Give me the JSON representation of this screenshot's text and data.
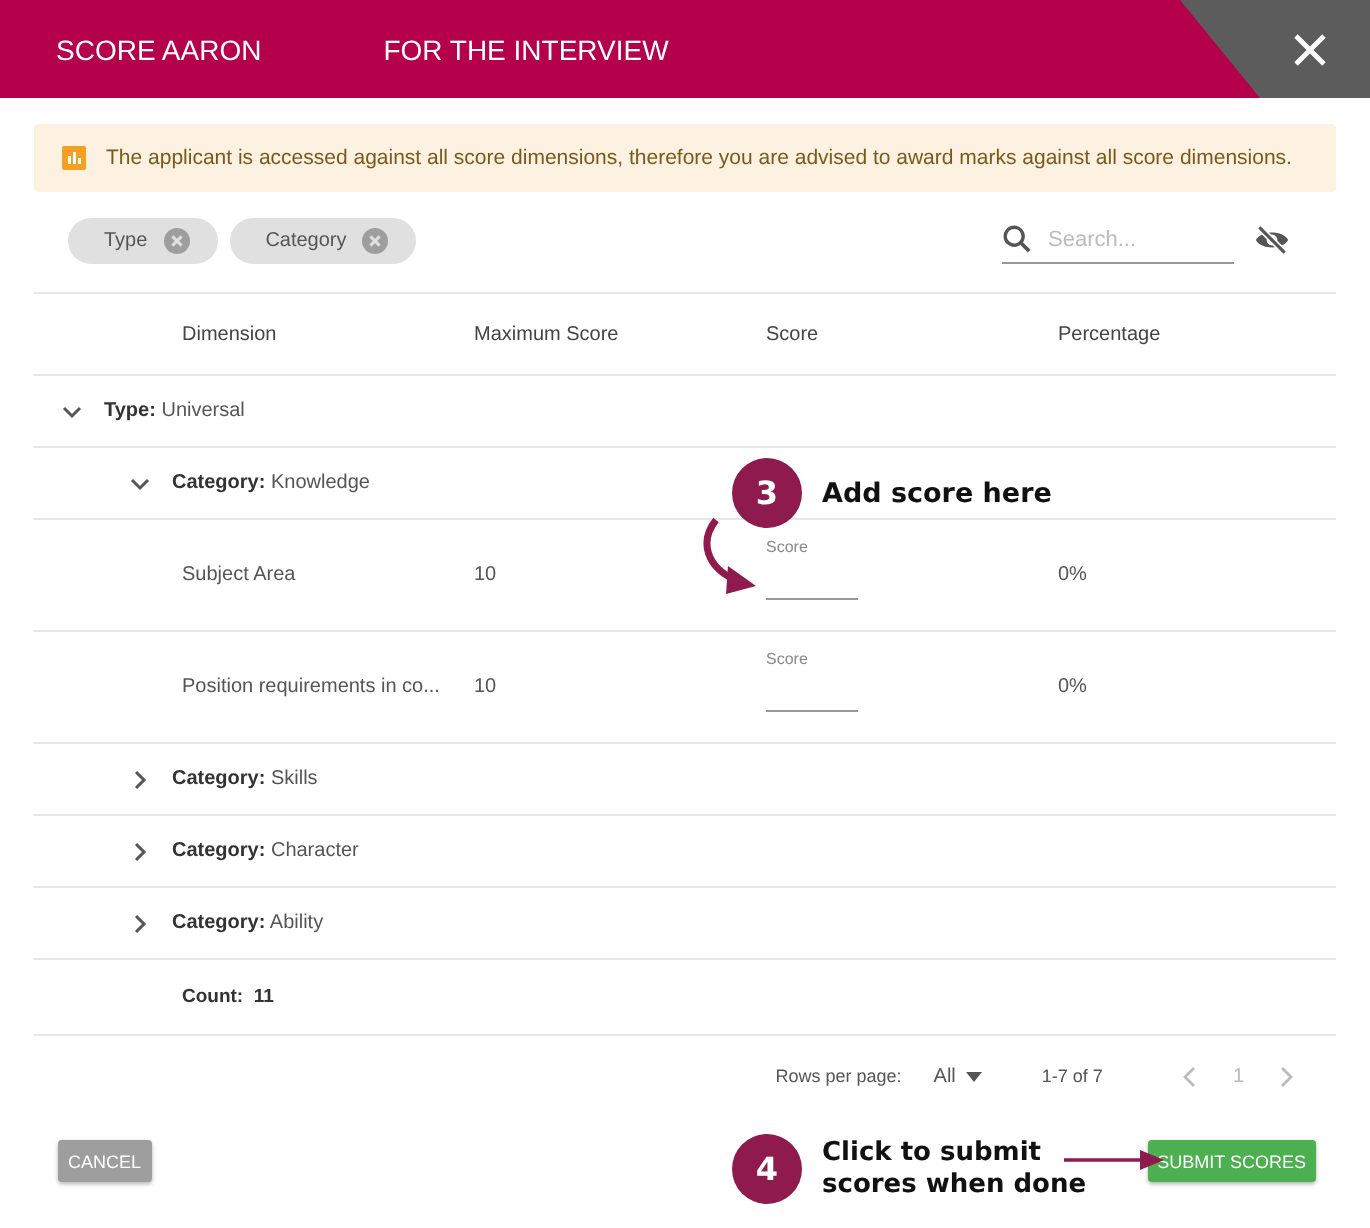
{
  "header": {
    "title": "SCORE AARON",
    "subtitle": "FOR THE INTERVIEW"
  },
  "alert": "The applicant is accessed against all score dimensions, therefore you are advised to award marks against all score dimensions.",
  "chips": [
    {
      "label": "Type"
    },
    {
      "label": "Category"
    }
  ],
  "search": {
    "placeholder": "Search..."
  },
  "table": {
    "columns": [
      "Dimension",
      "Maximum Score",
      "Score",
      "Percentage"
    ],
    "tree": [
      {
        "key": "Type:",
        "value": "Universal",
        "expanded": true,
        "children": [
          {
            "key": "Category:",
            "value": "Knowledge",
            "expanded": true,
            "children": [
              {
                "dimension": "Subject Area",
                "maximum_score": "10",
                "score_label": "Score",
                "percentage": "0%"
              },
              {
                "dimension": "Position requirements in co...",
                "maximum_score": "10",
                "score_label": "Score",
                "percentage": "0%"
              }
            ]
          },
          {
            "key": "Category:",
            "value": "Skills",
            "expanded": false
          },
          {
            "key": "Category:",
            "value": "Character",
            "expanded": false
          },
          {
            "key": "Category:",
            "value": "Ability",
            "expanded": false
          }
        ]
      }
    ],
    "count": {
      "label": "Count:",
      "value": "11"
    }
  },
  "pagination": {
    "rows_per_page_label": "Rows per page:",
    "rows_per_page": "All",
    "range": "1-7 of 7",
    "page": "1"
  },
  "buttons": {
    "cancel": "CANCEL",
    "submit": "SUBMIT SCORES"
  },
  "annotations": [
    {
      "number": "3",
      "text": "Add score here"
    },
    {
      "number": "4",
      "text": "Click to submit scores when done"
    }
  ]
}
